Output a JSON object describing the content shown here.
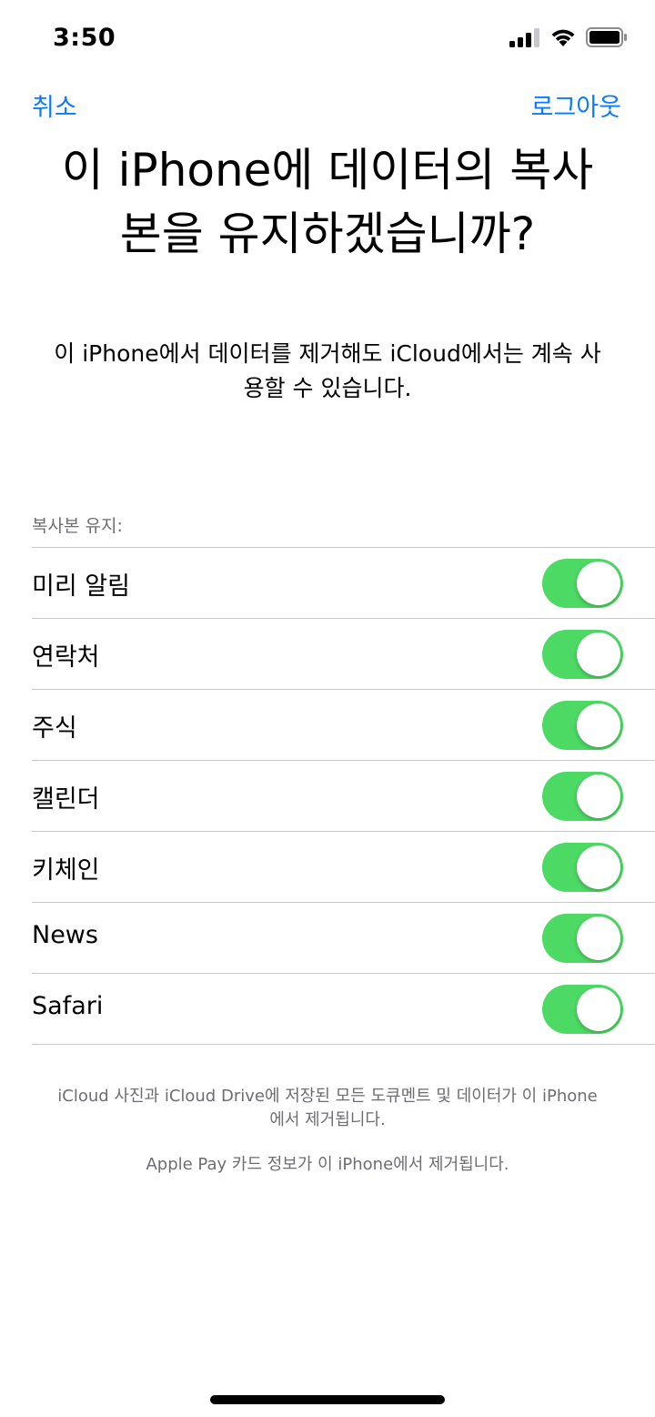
{
  "status_bar": {
    "time": "3:50",
    "icons": [
      "cellular-signal-icon",
      "wifi-icon",
      "battery-icon"
    ]
  },
  "nav": {
    "cancel_label": "취소",
    "logout_label": "로그아웃"
  },
  "title": {
    "line1": "이 iPhone에 데이터의 복사",
    "line2": "본을 유지하겠습니까?"
  },
  "subtitle": {
    "line1": "이 iPhone에서 데이터를 제거해도 iCloud에서는 계속 사",
    "line2": "용할 수 있습니다."
  },
  "section_header": "복사본 유지:",
  "toggles": [
    {
      "label": "미리 알림",
      "on": true
    },
    {
      "label": "연락처",
      "on": true
    },
    {
      "label": "주식",
      "on": true
    },
    {
      "label": "캘린더",
      "on": true
    },
    {
      "label": "키체인",
      "on": true
    },
    {
      "label": "News",
      "on": true
    },
    {
      "label": "Safari",
      "on": true
    }
  ],
  "footer": {
    "note1_line1": "iCloud 사진과 iCloud Drive에 저장된 모든 도큐멘트 및 데이터가 이 iPhone",
    "note1_line2": "에서 제거됩니다.",
    "note2": "Apple Pay 카드 정보가 이 iPhone에서 제거됩니다."
  },
  "colors": {
    "accent": "#0a7aff",
    "switch_on": "#4cd964",
    "secondary_text": "#6d6d72",
    "separator": "#c8c7cc"
  }
}
